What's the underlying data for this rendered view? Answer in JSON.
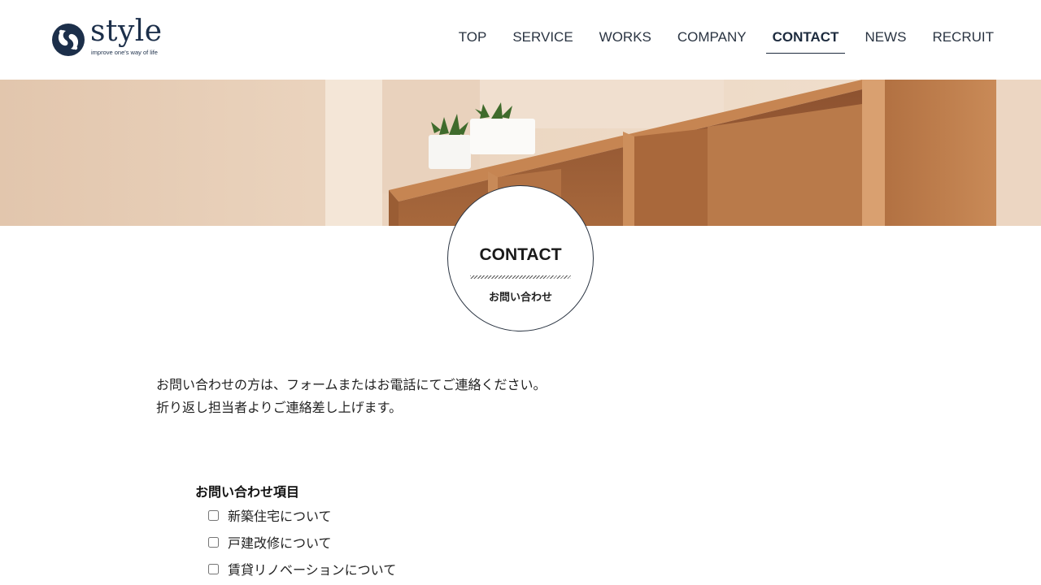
{
  "header": {
    "logo_word": "style",
    "logo_tagline": "improve one's way of life",
    "nav": [
      "TOP",
      "SERVICE",
      "WORKS",
      "COMPANY",
      "CONTACT",
      "NEWS",
      "RECRUIT"
    ],
    "active_nav": "CONTACT",
    "brand_color": "#1c2f4a"
  },
  "page_title": {
    "en": "CONTACT",
    "ja": "お問い合わせ"
  },
  "intro": {
    "line1": "お問い合わせの方は、フォームまたはお電話にてご連絡ください。",
    "line2": "折り返し担当者よりご連絡差し上げます。"
  },
  "form": {
    "inquiry_label": "お問い合わせ項目",
    "options": [
      {
        "label": "新築住宅について",
        "checked": false
      },
      {
        "label": "戸建改修について",
        "checked": false
      },
      {
        "label": "賃貸リノベーションについて",
        "checked": false
      }
    ]
  }
}
